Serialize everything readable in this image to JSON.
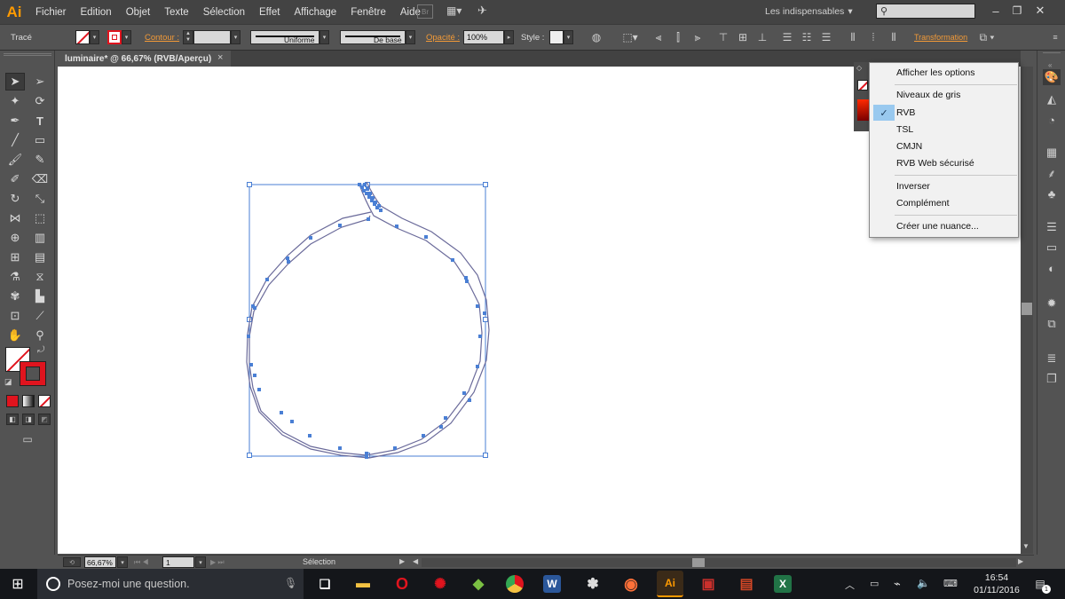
{
  "app": {
    "logo": "Ai"
  },
  "menu": [
    "Fichier",
    "Edition",
    "Objet",
    "Texte",
    "Sélection",
    "Effet",
    "Affichage",
    "Fenêtre",
    "Aide"
  ],
  "menubar_right": {
    "workspace": "Les indispensables",
    "search_placeholder": ""
  },
  "control": {
    "selection_label": "Tracé",
    "stroke_link": "Contour :",
    "stroke_profile": "Uniforme",
    "brush": "De base",
    "opacity_link": "Opacité :",
    "opacity_value": "100%",
    "style_label": "Style :",
    "transform_link": "Transformation"
  },
  "document": {
    "tab_title": "luminaire* @ 66,67% (RVB/Aperçu)",
    "close": "×"
  },
  "status": {
    "zoom": "66,67%",
    "page": "1",
    "tool": "Sélection"
  },
  "flyout": {
    "items": [
      {
        "label": "Afficher les options",
        "checked": false
      },
      {
        "label": "Niveaux de gris",
        "checked": false
      },
      {
        "label": "RVB",
        "checked": true
      },
      {
        "label": "TSL",
        "checked": false
      },
      {
        "label": "CMJN",
        "checked": false
      },
      {
        "label": "RVB Web sécurisé",
        "checked": false
      },
      {
        "label": "Inverser",
        "checked": false
      },
      {
        "label": "Complément",
        "checked": false
      },
      {
        "label": "Créer une nuance...",
        "checked": false
      }
    ],
    "check": "✓"
  },
  "taskbar": {
    "search_placeholder": "Posez-moi une question.",
    "time": "16:54",
    "date": "01/11/2016",
    "notification_count": "1"
  },
  "colors": {
    "accent": "#ff9a00",
    "selection_blue": "#4a7fd4",
    "stroke_red": "#e0141e",
    "checked_bg": "#99c9ef"
  }
}
